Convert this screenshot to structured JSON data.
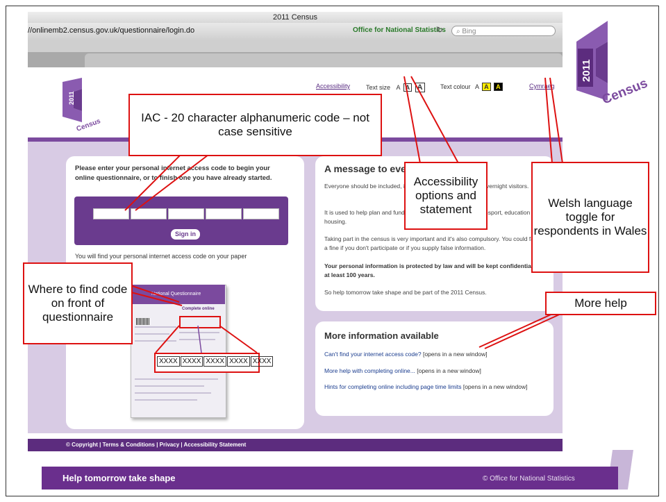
{
  "browser": {
    "window_title": "2011 Census",
    "url": "//onlinemb2.census.gov.uk/questionnaire/login.do",
    "site_identity": "Office for National Statistics",
    "search_placeholder": "Bing"
  },
  "logo": {
    "year": "2011",
    "word": "Census",
    "brand_color": "#7b4a9e"
  },
  "topnav": {
    "accessibility": "Accessibility",
    "text_size_label": "Text size",
    "text_size_options": [
      "A",
      "A",
      "A"
    ],
    "text_colour_label": "Text colour",
    "text_colour_options": [
      "A",
      "A",
      "A"
    ],
    "welsh": "Cymraeg"
  },
  "login": {
    "prompt": "Please enter your personal internet access code to begin your online questionnaire, or to finish one you have already started.",
    "sign_in": "Sign in",
    "paper_note": "You will find your personal internet access code on your paper",
    "doc_title": "National Questionnaire",
    "doc_complete_online": "Complete online",
    "code_segments": [
      "XXXX",
      "XXXX",
      "XXXX",
      "XXXX",
      "XXXX"
    ]
  },
  "message": {
    "title": "A message to everyone",
    "p1": "Everyone should be included, including babies, children and overnight visitors.",
    "p2": "It is used to help plan and fund services including schools, transport, education and housing.",
    "p3": "Taking part in the census is very important and it's also compulsory. You could face a fine if you don't participate or if you supply false information.",
    "p4": "Your personal information is protected by law and will be kept confidential for at least 100 years.",
    "p5": "So help tomorrow take shape and be part of the 2011 Census."
  },
  "more_info": {
    "title": "More information available",
    "links": [
      {
        "text": "Can't find your internet access code?",
        "suffix": " [opens in a new window]"
      },
      {
        "text": "More help with completing online...",
        "suffix": " [opens in a new window]"
      },
      {
        "text": "Hints for completing online including page time limits",
        "suffix": " [opens in a new window]"
      }
    ]
  },
  "footer": {
    "links": "© Copyright  |  Terms & Conditions  |  Privacy  |  Accessibility Statement",
    "slogan": "Help tomorrow take shape",
    "org": "© Office for National Statistics"
  },
  "callouts": {
    "iac": "IAC - 20 character alphanumeric code – not case sensitive",
    "accessibility": "Accessibility options and statement",
    "welsh": "Welsh language toggle for respondents in Wales",
    "where": "Where to find code on front of questionnaire",
    "more_help": "More help"
  },
  "colors": {
    "callout_red": "#d11111",
    "footer_purple": "#5c2c7e",
    "page_lavender": "#d8cbe4"
  }
}
